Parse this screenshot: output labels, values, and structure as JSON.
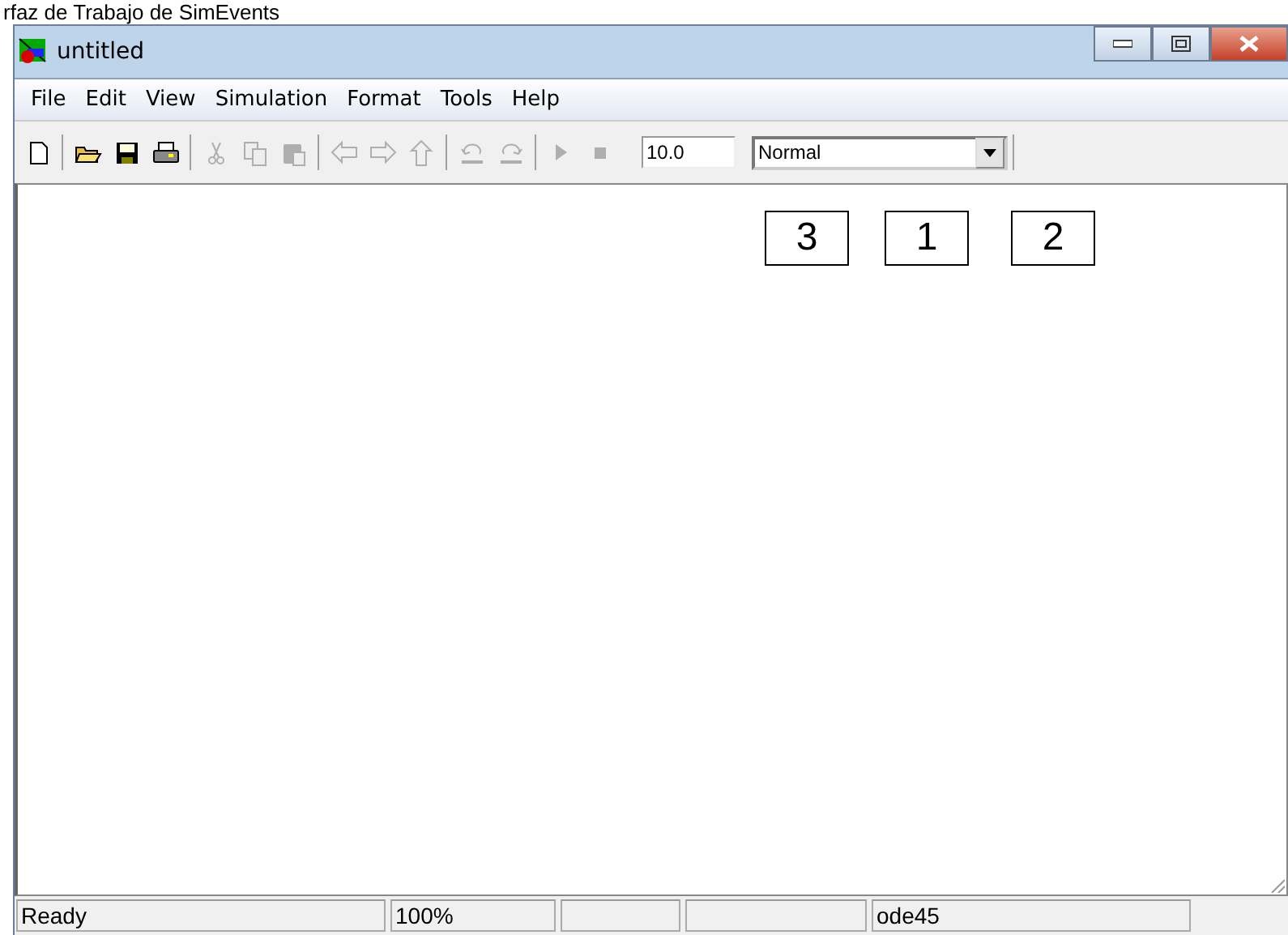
{
  "caption": "rfaz de Trabajo de SimEvents",
  "window": {
    "title": "untitled"
  },
  "menu": [
    "File",
    "Edit",
    "View",
    "Simulation",
    "Format",
    "Tools",
    "Help"
  ],
  "toolbar": [
    {
      "kind": "new",
      "disabled": false
    },
    {
      "kind": "sep"
    },
    {
      "kind": "open",
      "disabled": false
    },
    {
      "kind": "save",
      "disabled": false
    },
    {
      "kind": "print",
      "disabled": false
    },
    {
      "kind": "sep"
    },
    {
      "kind": "cut",
      "disabled": true
    },
    {
      "kind": "copy",
      "disabled": true
    },
    {
      "kind": "paste",
      "disabled": true
    },
    {
      "kind": "sep"
    },
    {
      "kind": "back",
      "disabled": true
    },
    {
      "kind": "forward",
      "disabled": true
    },
    {
      "kind": "up",
      "disabled": true
    },
    {
      "kind": "sep"
    },
    {
      "kind": "undo",
      "disabled": true
    },
    {
      "kind": "redo",
      "disabled": true
    },
    {
      "kind": "sep"
    },
    {
      "kind": "play",
      "disabled": true
    },
    {
      "kind": "stop",
      "disabled": true
    }
  ],
  "stop_time": {
    "value": "10.0"
  },
  "mode": {
    "value": "Normal"
  },
  "annotations": [
    "3",
    "1",
    "2"
  ],
  "status_bar": {
    "message": "Ready",
    "zoom": "100%",
    "solver": "ode45"
  }
}
